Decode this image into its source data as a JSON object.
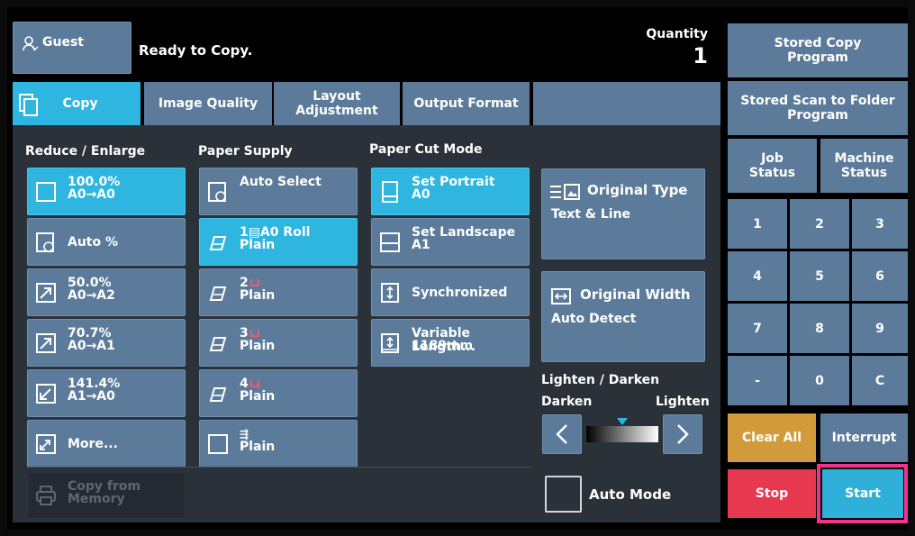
{
  "header": {
    "user_label": "Guest",
    "status": "Ready to Copy.",
    "quantity_label": "Quantity",
    "quantity_value": "1"
  },
  "tabs": [
    {
      "label": "Copy"
    },
    {
      "label": "Image Quality"
    },
    {
      "label": "Layout\nAdjustment"
    },
    {
      "label": "Output Format"
    }
  ],
  "reduce_enlarge": {
    "heading": "Reduce / Enlarge",
    "items": [
      {
        "line1": "100.0%",
        "line2": "A0→A0"
      },
      {
        "line1": "Auto %",
        "line2": ""
      },
      {
        "line1": "50.0%",
        "line2": "A0→A2"
      },
      {
        "line1": "70.7%",
        "line2": "A0→A1"
      },
      {
        "line1": "141.4%",
        "line2": "A1→A0"
      },
      {
        "line1": "More...",
        "line2": ""
      }
    ]
  },
  "paper_supply": {
    "heading": "Paper Supply",
    "items": [
      {
        "line1": "Auto Select",
        "line2": ""
      },
      {
        "line1": "1▤A0 Roll",
        "line2": "Plain"
      },
      {
        "line1": "2",
        "line2": "Plain"
      },
      {
        "line1": "3",
        "line2": "Plain"
      },
      {
        "line1": "4",
        "line2": "Plain"
      },
      {
        "line1": "",
        "line2": "Plain"
      }
    ]
  },
  "paper_cut": {
    "heading": "Paper Cut Mode",
    "items": [
      {
        "line1": "Set Portrait",
        "line2": "A0"
      },
      {
        "line1": "Set Landscape",
        "line2": "A1"
      },
      {
        "line1": "Synchronized",
        "line2": ""
      },
      {
        "line1": "Variable Length...",
        "line2": "1189mm"
      }
    ]
  },
  "original_type": {
    "title": "Original Type",
    "value": "Text & Line"
  },
  "original_width": {
    "title": "Original Width",
    "value": "Auto Detect"
  },
  "lighten_darken": {
    "heading": "Lighten / Darken",
    "darken": "Darken",
    "lighten": "Lighten",
    "level_fraction": 0.5
  },
  "auto_mode": "Auto Mode",
  "copy_from_memory": {
    "line1": "Copy from",
    "line2": "Memory"
  },
  "right_panel": {
    "stored_copy": "Stored Copy\nProgram",
    "stored_scan": "Stored Scan to Folder\nProgram",
    "job_status": "Job\nStatus",
    "machine_status": "Machine\nStatus",
    "keypad": [
      "1",
      "2",
      "3",
      "4",
      "5",
      "6",
      "7",
      "8",
      "9",
      "-",
      "0",
      "C"
    ],
    "clear_all": "Clear All",
    "interrupt": "Interrupt",
    "stop": "Stop",
    "start": "Start"
  },
  "colors": {
    "button": "#5c7b9a",
    "selected": "#2eb6e0",
    "clear_all": "#d29a3b",
    "stop": "#e8384f",
    "start": "#2eb0d8",
    "start_highlight": "#f0348e"
  }
}
